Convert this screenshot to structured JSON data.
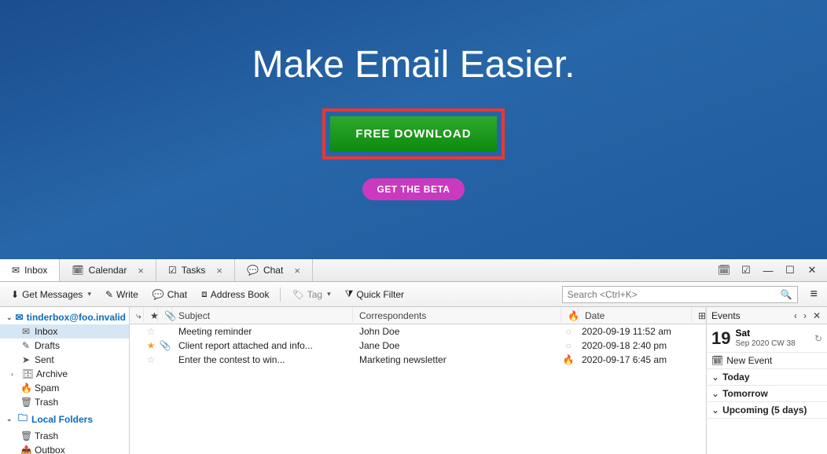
{
  "hero": {
    "title": "Make Email Easier.",
    "download_label": "FREE DOWNLOAD",
    "beta_label": "GET THE BETA"
  },
  "tabs": [
    {
      "icon": "mail",
      "label": "Inbox",
      "closable": false,
      "active": true
    },
    {
      "icon": "calendar",
      "label": "Calendar",
      "closable": true
    },
    {
      "icon": "tasks",
      "label": "Tasks",
      "closable": true
    },
    {
      "icon": "chat",
      "label": "Chat",
      "closable": true
    }
  ],
  "toolbar": {
    "get_messages": "Get Messages",
    "write": "Write",
    "chat": "Chat",
    "address_book": "Address Book",
    "tag": "Tag",
    "quick_filter": "Quick Filter",
    "search_placeholder": "Search <Ctrl+K>"
  },
  "folders": {
    "account": "tinderbox@foo.invalid",
    "items": [
      "Inbox",
      "Drafts",
      "Sent",
      "Archive",
      "Spam",
      "Trash"
    ],
    "local_label": "Local Folders",
    "local_items": [
      "Trash",
      "Outbox"
    ]
  },
  "columns": {
    "subject": "Subject",
    "correspondents": "Correspondents",
    "date": "Date"
  },
  "messages": [
    {
      "star": false,
      "attach": false,
      "subject": "Meeting reminder",
      "from": "John Doe",
      "fire": false,
      "date": "2020-09-19 11:52 am"
    },
    {
      "star": true,
      "attach": true,
      "subject": "Client report attached and info...",
      "from": "Jane Doe",
      "fire": false,
      "date": "2020-09-18 2:40 pm"
    },
    {
      "star": false,
      "attach": false,
      "subject": "Enter the contest to win...",
      "from": "Marketing newsletter",
      "fire": true,
      "date": "2020-09-17 6:45 am"
    }
  ],
  "events": {
    "title": "Events",
    "day": "19",
    "dow": "Sat",
    "sub": "Sep 2020 CW 38",
    "new_label": "New Event",
    "sections": [
      "Today",
      "Tomorrow",
      "Upcoming (5 days)"
    ]
  }
}
